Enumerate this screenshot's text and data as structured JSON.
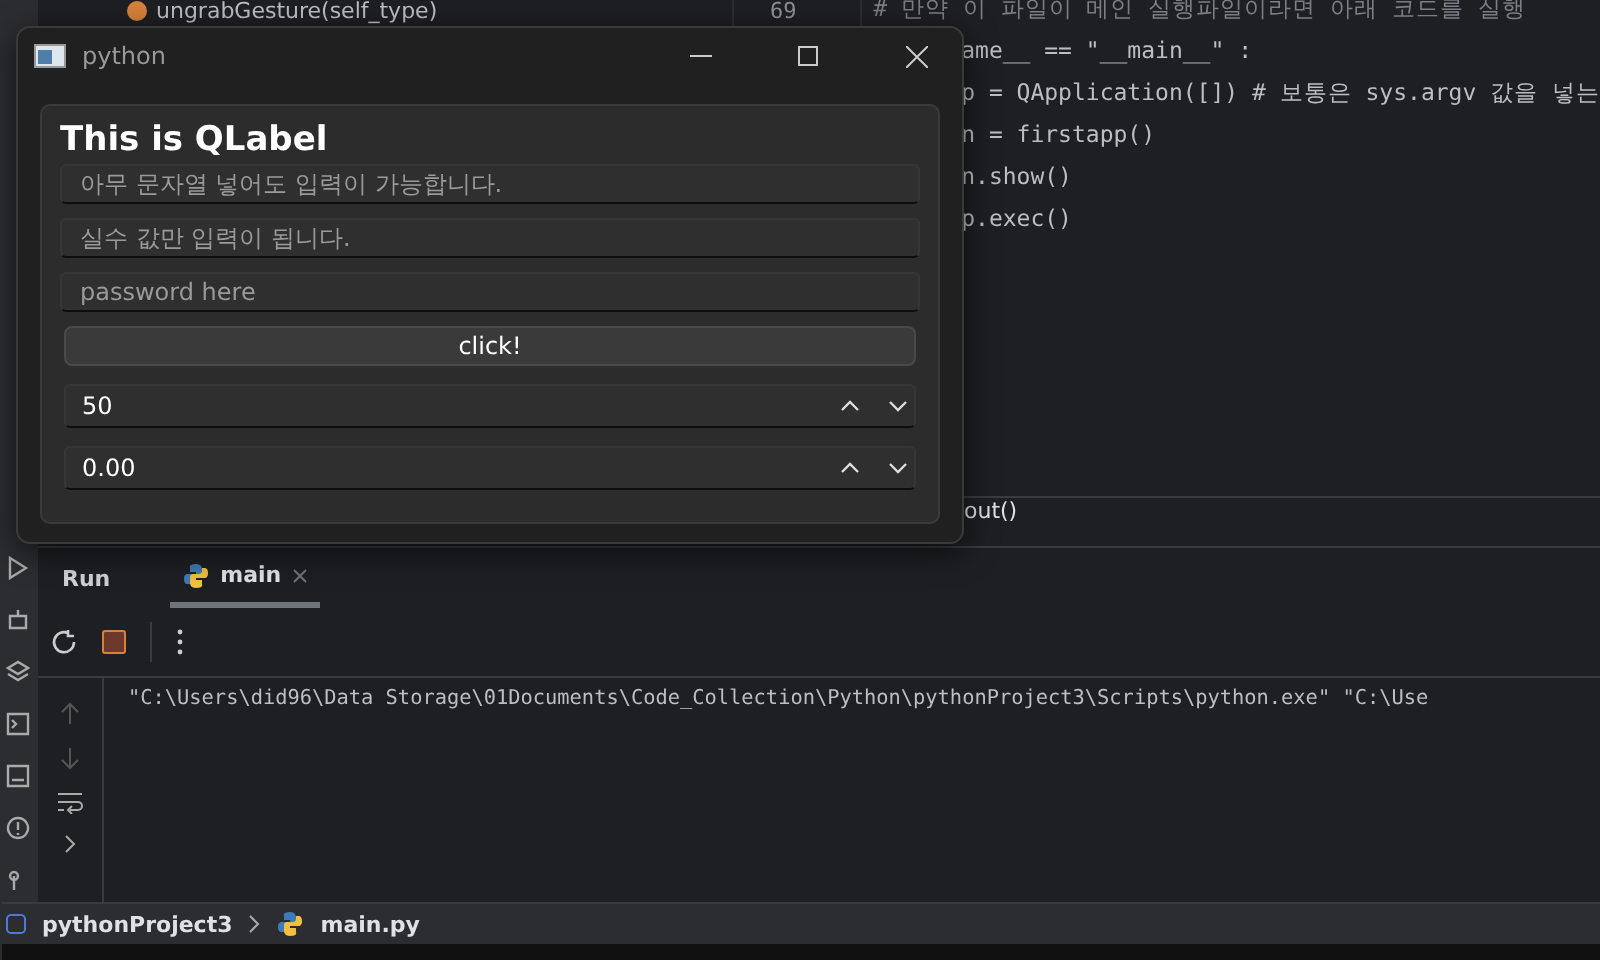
{
  "ide": {
    "structure_item": "ungrabGesture(self_type)",
    "line_number": "69",
    "code_lines": [
      {
        "kind": "comment",
        "text": "# 만약 이 파일이 메인 실행파일이라면 아래 코드를 실행"
      },
      {
        "kind": "code",
        "text": "ame__ == \"__main__\" :"
      },
      {
        "kind": "code",
        "text": "p = QApplication([]) # 보통은 sys.argv 값을 넣는"
      },
      {
        "kind": "code",
        "text": "n = firstapp()"
      },
      {
        "kind": "code",
        "text": "n.show()"
      },
      {
        "kind": "code",
        "text": "p.exec()"
      }
    ],
    "breadcrumb": "out()",
    "run_panel": {
      "title": "Run",
      "tabs": [
        {
          "label": "main",
          "selected": true
        }
      ],
      "console_lines": [
        "\"C:\\Users\\did96\\Data Storage\\01Documents\\Code_Collection\\Python\\pythonProject3\\Scripts\\python.exe\" \"C:\\Use"
      ]
    },
    "navigation": [
      "pythonProject3",
      "main.py"
    ]
  },
  "window": {
    "title": "python",
    "label": "This is QLabel",
    "fields": [
      {
        "placeholder": "아무 문자열 넣어도 입력이 가능합니다."
      },
      {
        "placeholder": "실수 값만 입력이 됩니다."
      },
      {
        "placeholder": "password here"
      }
    ],
    "button": "click!",
    "spinboxes": [
      {
        "value": "50"
      },
      {
        "value": "0.00"
      }
    ]
  }
}
